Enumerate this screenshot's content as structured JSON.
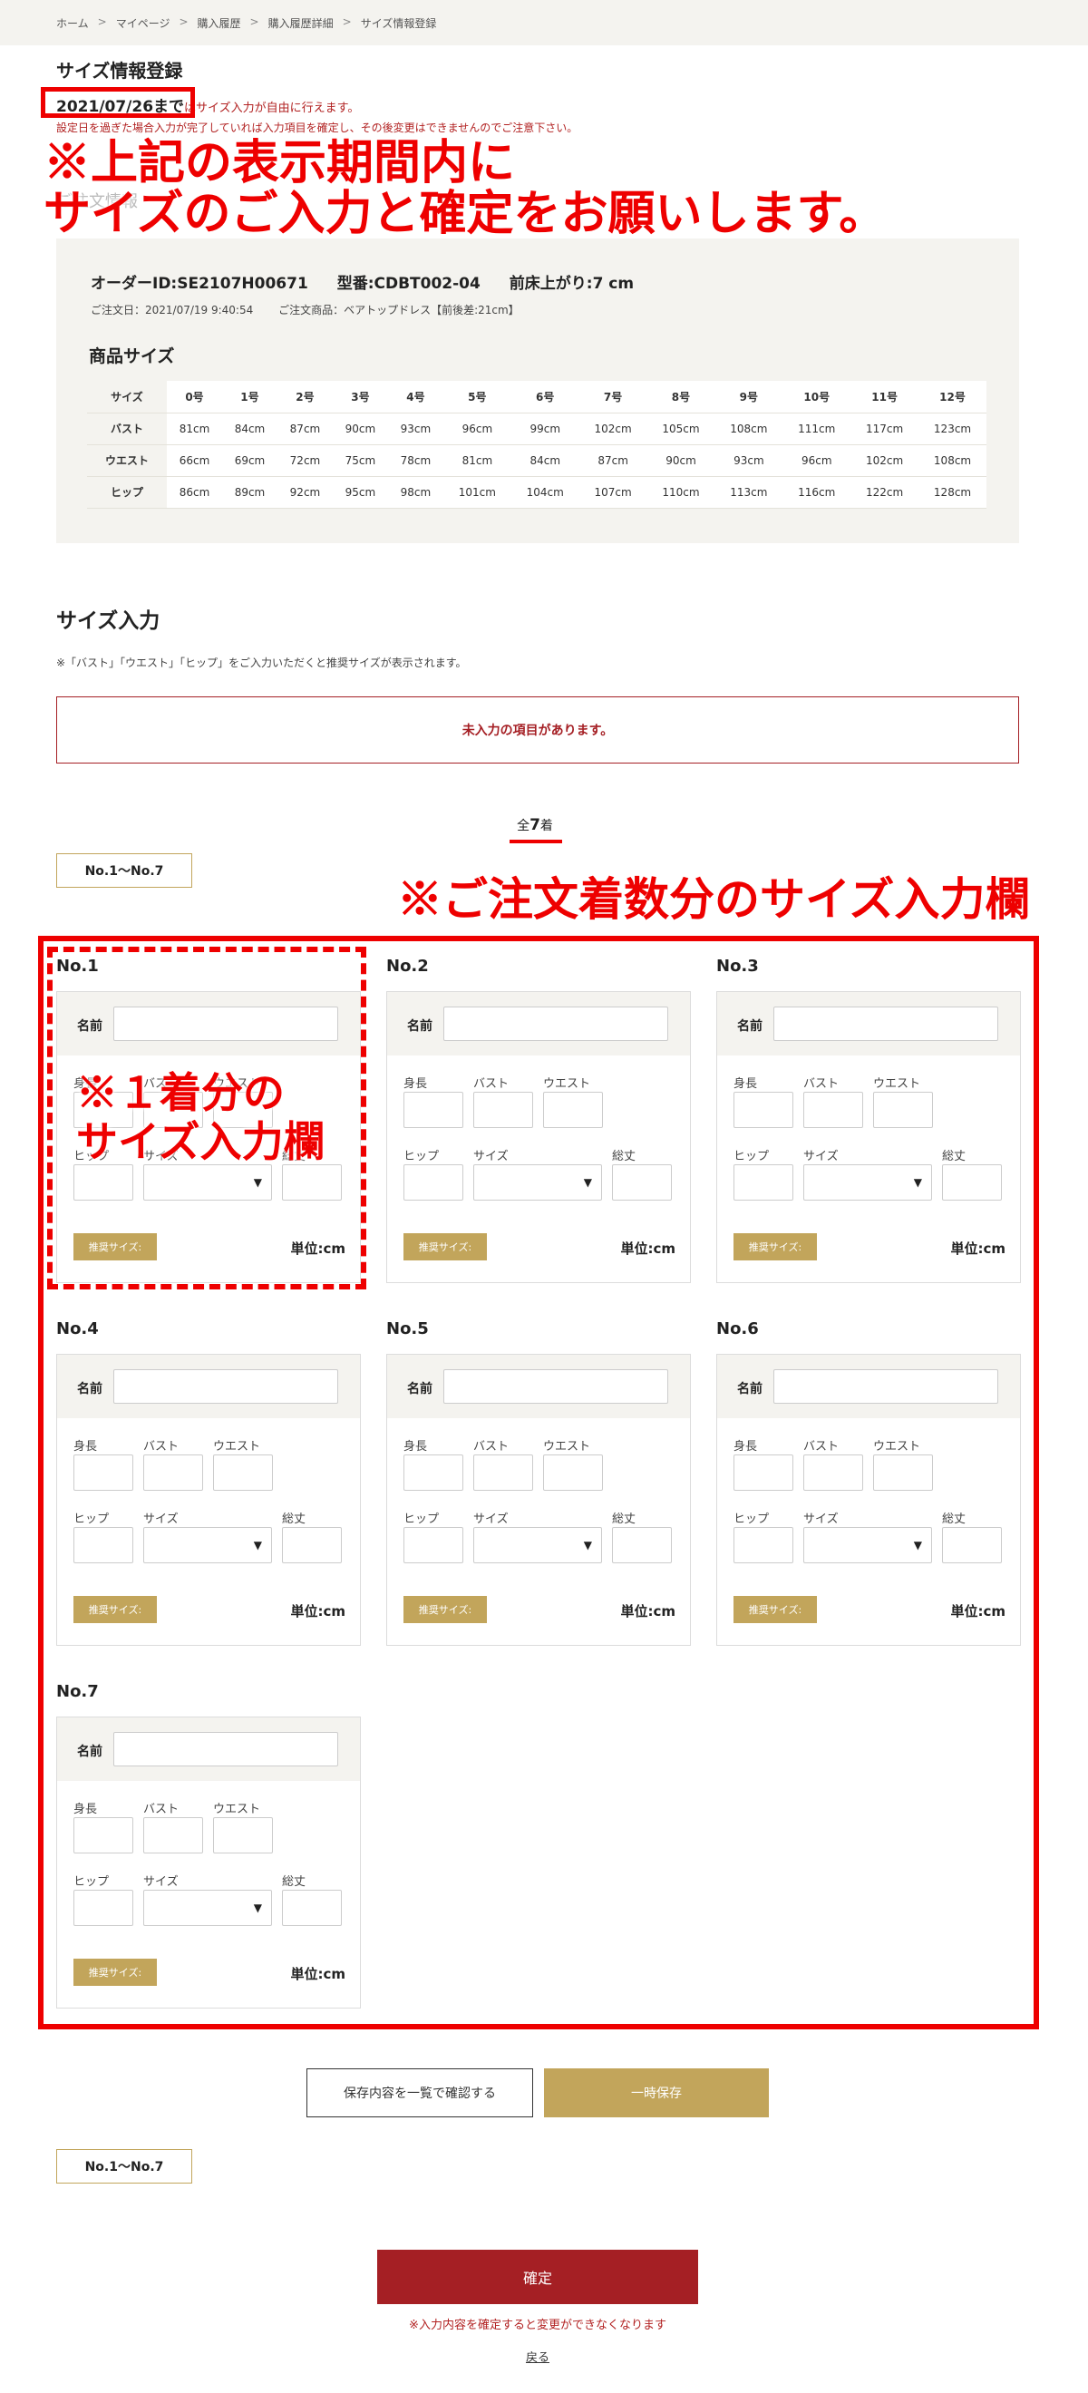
{
  "breadcrumb": [
    "ホーム",
    "マイページ",
    "購入履歴",
    "購入履歴詳細",
    "サイズ情報登録"
  ],
  "page_title": "サイズ情報登録",
  "deadline": {
    "date": "2021/07/26まで",
    "text": "はサイズ入力が自由に行えます。",
    "notice": "設定日を過ぎた場合入力が完了していれば入力項目を確定し、その後変更はできませんのでご注意下さい。"
  },
  "annotations": {
    "overlay_line1": "※上記の表示期間内に",
    "overlay_line2": "サイズのご入力と確定をお願いします。",
    "order_count_note": "※ご注文着数分のサイズ入力欄",
    "single_line1": "※１着分の",
    "single_line2": "サイズ入力欄"
  },
  "order": {
    "heading": "ご注文情報",
    "order_id": "オーダーID:SE2107H00671",
    "model": "型番:CDBT002-04",
    "front_rise": "前床上がり:7 cm",
    "order_date": "ご注文日：2021/07/19 9:40:54",
    "product": "ご注文商品：ベアトップドレス【前後差:21cm】"
  },
  "product_size": {
    "title": "商品サイズ",
    "headers": [
      "サイズ",
      "0号",
      "1号",
      "2号",
      "3号",
      "4号",
      "5号",
      "6号",
      "7号",
      "8号",
      "9号",
      "10号",
      "11号",
      "12号"
    ],
    "rows": [
      {
        "label": "バスト",
        "values": [
          "81cm",
          "84cm",
          "87cm",
          "90cm",
          "93cm",
          "96cm",
          "99cm",
          "102cm",
          "105cm",
          "108cm",
          "111cm",
          "117cm",
          "123cm"
        ]
      },
      {
        "label": "ウエスト",
        "values": [
          "66cm",
          "69cm",
          "72cm",
          "75cm",
          "78cm",
          "81cm",
          "84cm",
          "87cm",
          "90cm",
          "93cm",
          "96cm",
          "102cm",
          "108cm"
        ]
      },
      {
        "label": "ヒップ",
        "values": [
          "86cm",
          "89cm",
          "92cm",
          "95cm",
          "98cm",
          "101cm",
          "104cm",
          "107cm",
          "110cm",
          "113cm",
          "116cm",
          "122cm",
          "128cm"
        ]
      }
    ]
  },
  "size_input": {
    "title": "サイズ入力",
    "note": "※「バスト」「ウエスト」「ヒップ」をご入力いただくと推奨サイズが表示されます。",
    "error": "未入力の項目があります。",
    "total_prefix": "全",
    "total_count": "7",
    "total_suffix": "着",
    "range_label": "No.1〜No.7"
  },
  "form_labels": {
    "name": "名前",
    "height": "身長",
    "bust": "バスト",
    "waist": "ウエスト",
    "hip": "ヒップ",
    "size": "サイズ",
    "length": "総丈",
    "recommended": "推奨サイズ:",
    "unit": "単位:cm"
  },
  "items": [
    "No.1",
    "No.2",
    "No.3",
    "No.4",
    "No.5",
    "No.6",
    "No.7"
  ],
  "actions": {
    "confirm_list": "保存内容を一覧で確認する",
    "temp_save": "一時保存",
    "submit": "確定",
    "submit_note": "※入力内容を確定すると変更ができなくなります",
    "back": "戻る"
  },
  "colors": {
    "accent_gold": "#c2a55b",
    "submit_red": "#a51f24",
    "annotation_red": "#ee0000",
    "panel_beige": "#f4f3ef"
  }
}
